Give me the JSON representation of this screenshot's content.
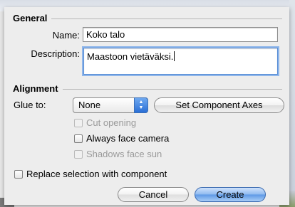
{
  "general": {
    "title": "General",
    "name_label": "Name:",
    "name_value": "Koko talo",
    "description_label": "Description:",
    "description_value": "Maastoon vietäväksi."
  },
  "alignment": {
    "title": "Alignment",
    "glue_label": "Glue to:",
    "glue_value": "None",
    "set_axes_button": "Set Component Axes",
    "cut_opening": {
      "label": "Cut opening",
      "checked": false,
      "enabled": false
    },
    "always_face_camera": {
      "label": "Always face camera",
      "checked": false,
      "enabled": true
    },
    "shadows_face_sun": {
      "label": "Shadows face sun",
      "checked": false,
      "enabled": false
    }
  },
  "replace_selection": {
    "label": "Replace selection with component",
    "checked": false
  },
  "buttons": {
    "cancel": "Cancel",
    "create": "Create"
  },
  "colors": {
    "accent": "#5c98e6",
    "focus_ring": "#8fb6ea"
  }
}
